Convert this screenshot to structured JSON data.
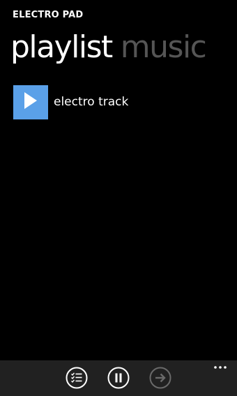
{
  "app": {
    "title": "ELECTRO PAD"
  },
  "pivot": {
    "headers": [
      {
        "label": "playlist",
        "active": true
      },
      {
        "label": "music",
        "active": false
      }
    ]
  },
  "playlist": {
    "items": [
      {
        "title": "electro track",
        "icon": "play-icon"
      }
    ]
  },
  "app_bar": {
    "buttons": [
      {
        "icon": "playlist-icon",
        "enabled": true
      },
      {
        "icon": "pause-icon",
        "enabled": true
      },
      {
        "icon": "next-arrow-icon",
        "enabled": false
      }
    ],
    "more": "more-options-icon"
  },
  "colors": {
    "background": "#000000",
    "accent": "#5aa0e8",
    "inactive_header": "#555555",
    "app_bar": "#212121",
    "disabled_icon": "#6a6a6a"
  }
}
